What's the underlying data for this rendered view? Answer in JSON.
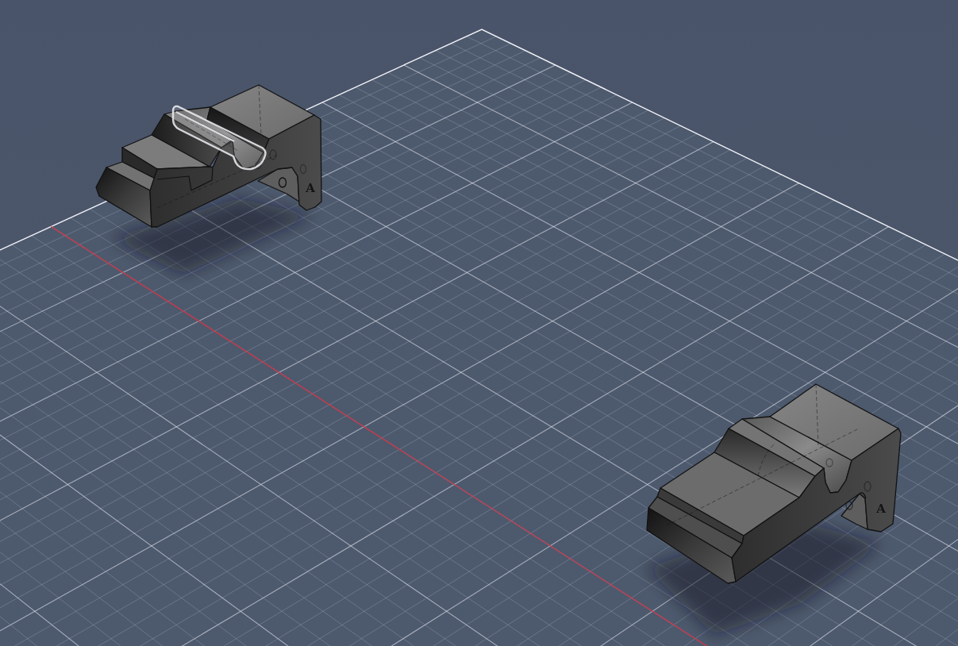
{
  "viewport": {
    "parts": [
      {
        "engraving": "A",
        "highlight": true
      },
      {
        "engraving": "A",
        "highlight": false
      }
    ]
  }
}
